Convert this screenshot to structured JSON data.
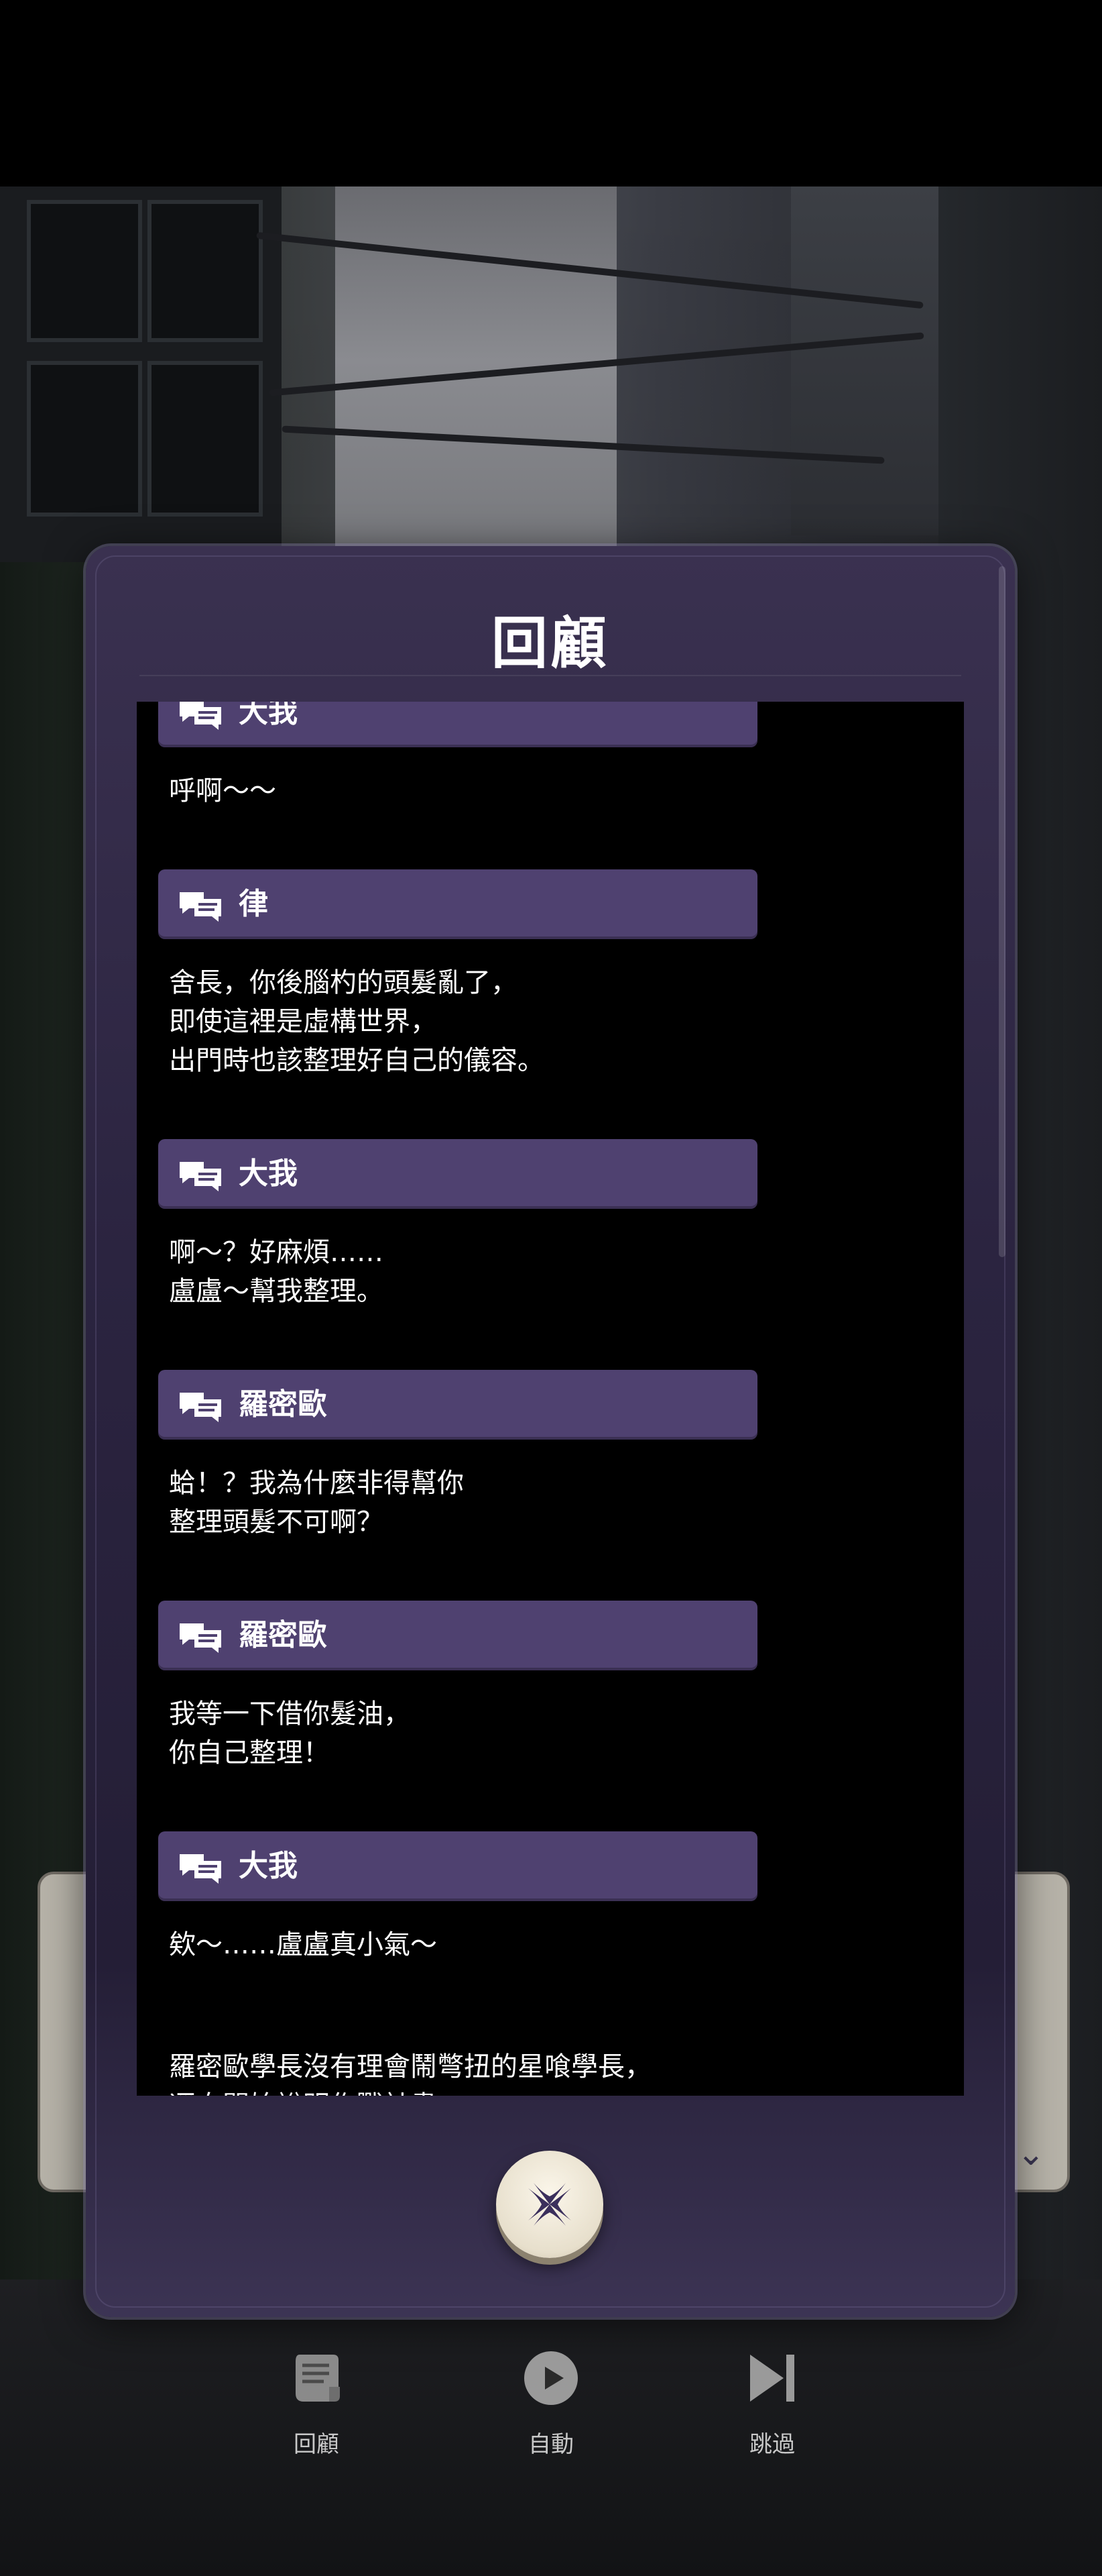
{
  "dialog": {
    "title": "回顧",
    "close_icon": "sparkle-x-icon"
  },
  "log": [
    {
      "speaker": "大我",
      "lines": [
        "呼啊～～"
      ]
    },
    {
      "speaker": "律",
      "lines": [
        "舍長，你後腦杓的頭髮亂了，",
        "即使這裡是虛構世界，",
        "出門時也該整理好自己的儀容。"
      ]
    },
    {
      "speaker": "大我",
      "lines": [
        "啊～？好麻煩……",
        "盧盧～幫我整理。"
      ]
    },
    {
      "speaker": "羅密歐",
      "lines": [
        "蛤！？我為什麼非得幫你",
        "整理頭髮不可啊？"
      ]
    },
    {
      "speaker": "羅密歐",
      "lines": [
        "我等一下借你髮油，",
        "你自己整理！"
      ]
    },
    {
      "speaker": "大我",
      "lines": [
        "欸～……盧盧真小氣～"
      ]
    },
    {
      "speaker": "",
      "lines": [
        "羅密歐學長沒有理會鬧彆扭的星喰學長，",
        "逕自開始說明作戰計畫。"
      ]
    }
  ],
  "controls": {
    "review": {
      "label": "回顧",
      "icon": "scroll-icon"
    },
    "auto": {
      "label": "自動",
      "icon": "play-icon"
    },
    "skip": {
      "label": "跳過",
      "icon": "skip-icon"
    }
  },
  "colors": {
    "speaker_bar": "#4f4170",
    "dialog_bg": "#2b2440",
    "log_bg": "#000000"
  }
}
